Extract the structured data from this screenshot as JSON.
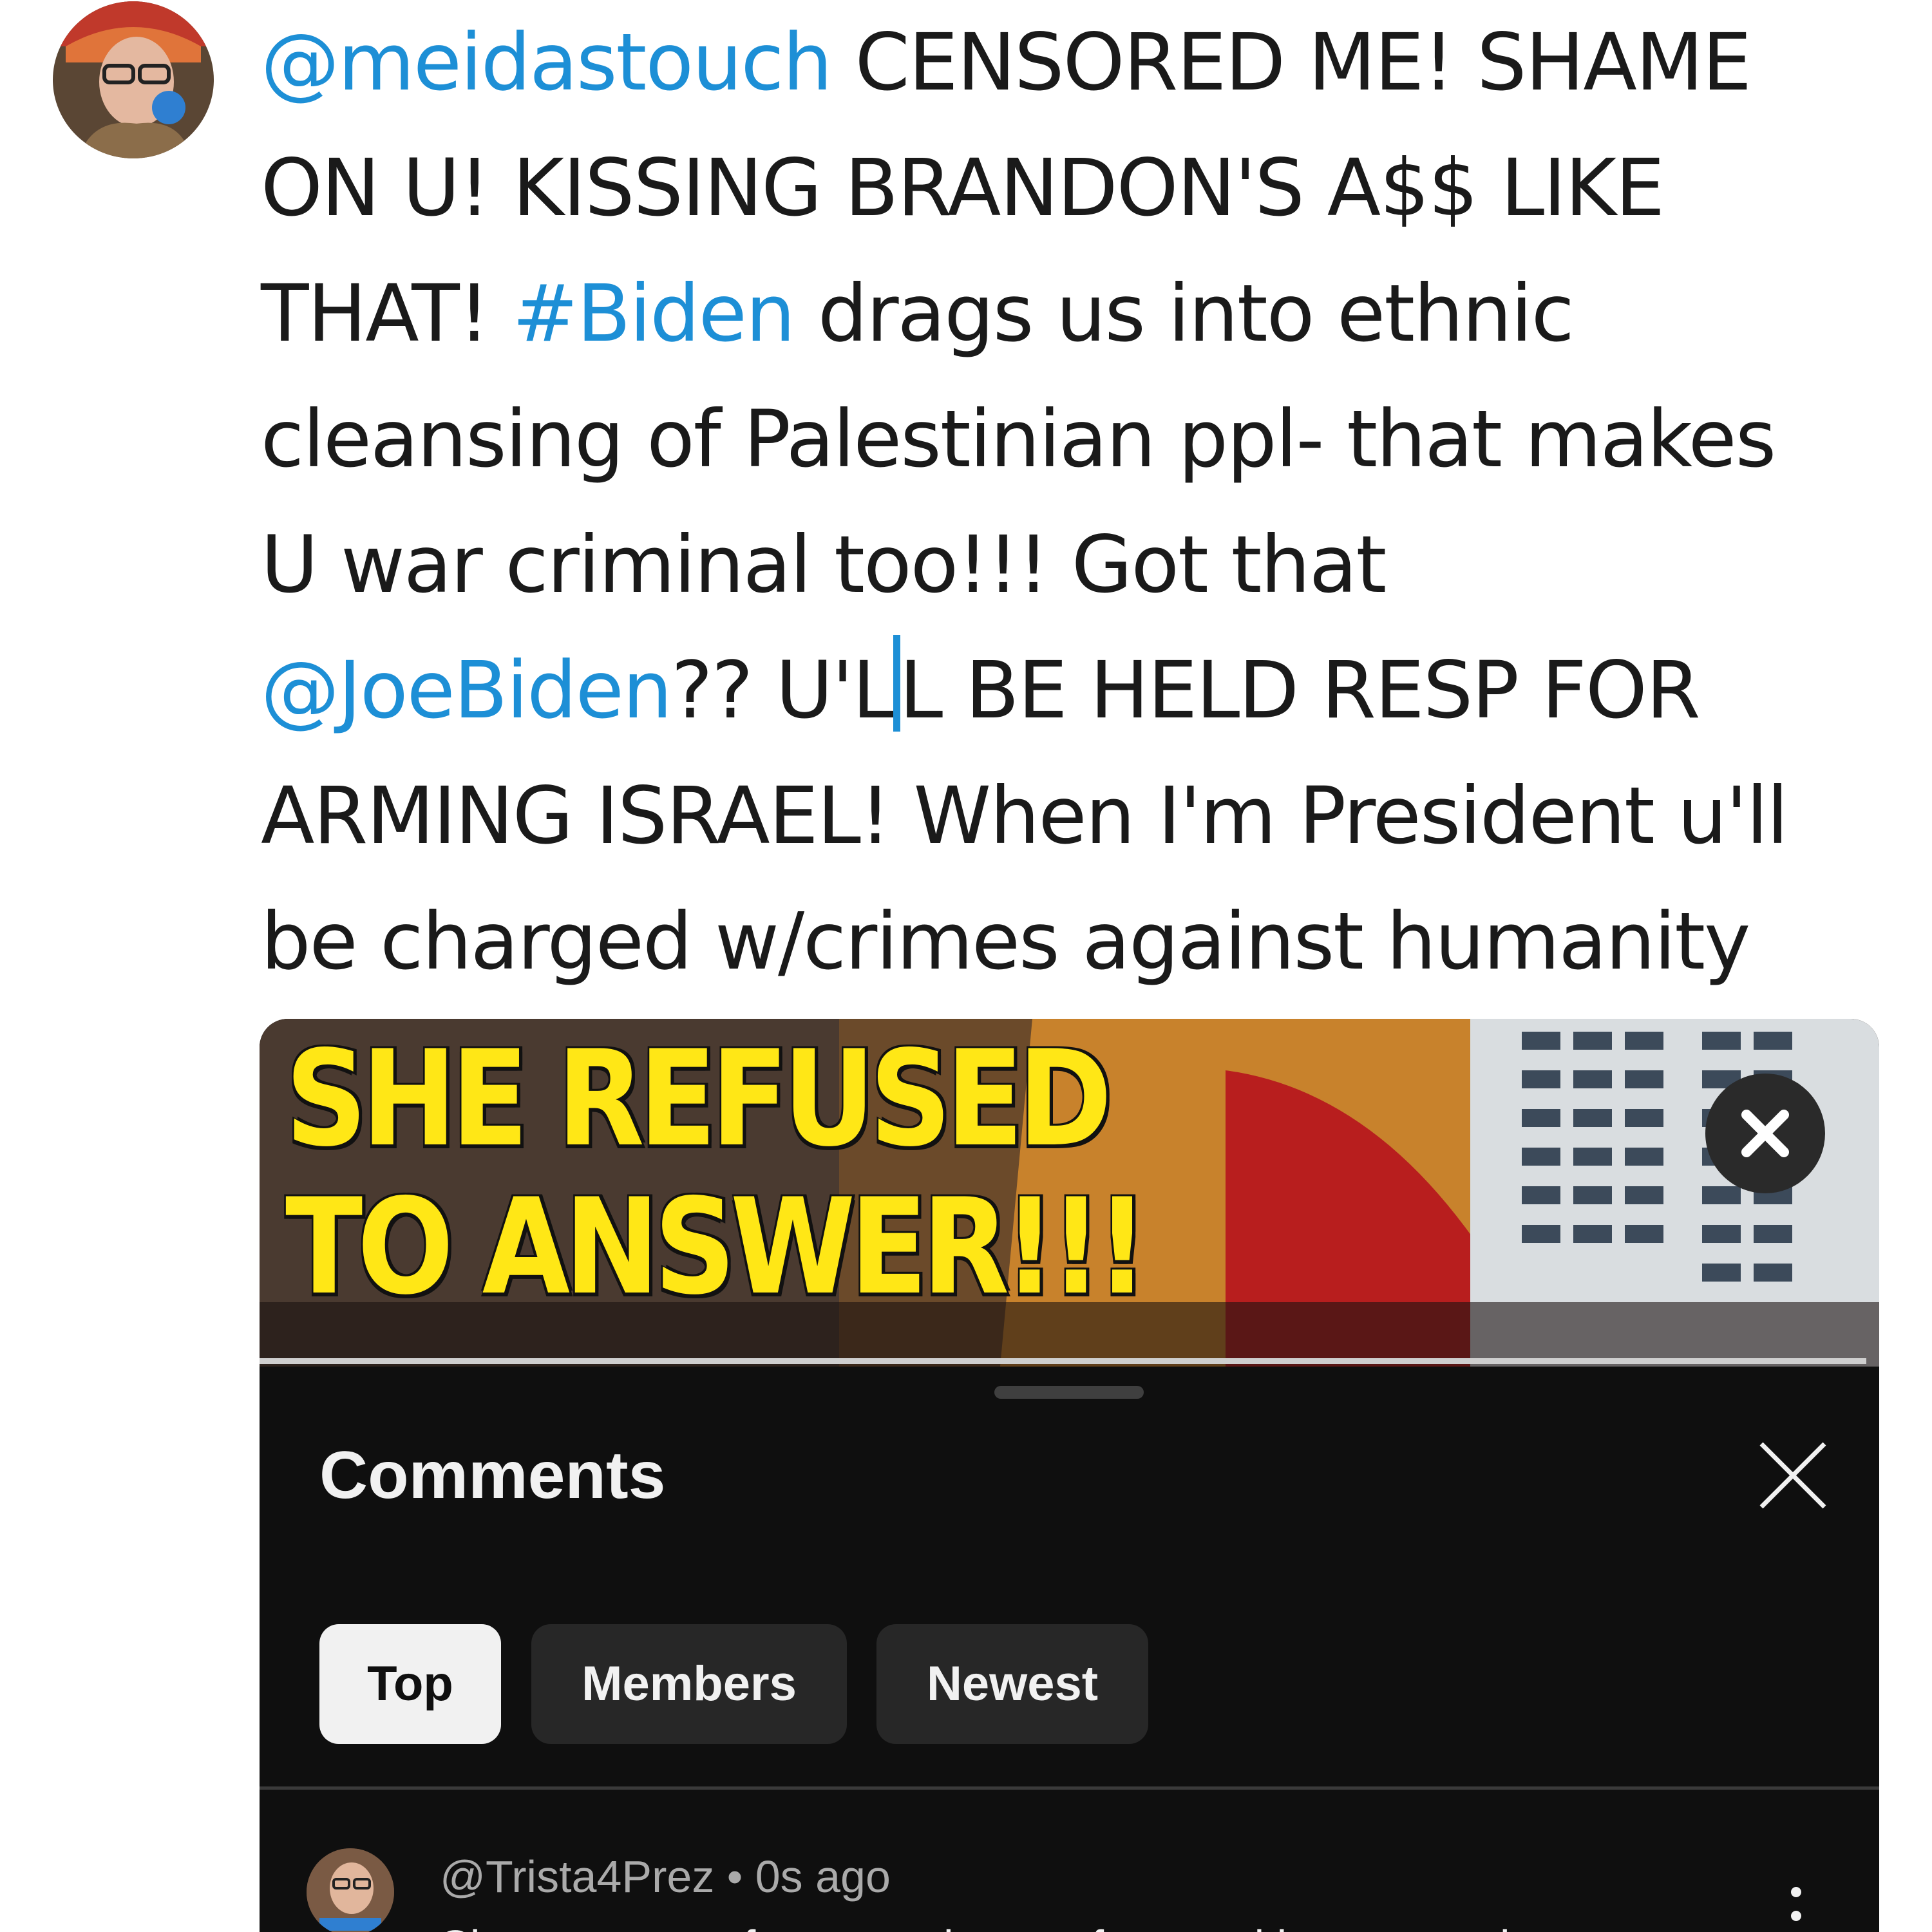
{
  "tweet": {
    "lines": [
      [
        {
          "t": "@meidastouch",
          "link": true
        },
        {
          "t": " CENSORED ME! SHAME"
        }
      ],
      [
        {
          "t": "ON U! KISSING BRANDON'S A$$ LIKE"
        }
      ],
      [
        {
          "t": "THAT! "
        },
        {
          "t": "#Biden",
          "link": true
        },
        {
          "t": " drags us into ethnic"
        }
      ],
      [
        {
          "t": "cleansing of Palestinian ppl- that makes"
        }
      ],
      [
        {
          "t": "U war criminal too!!! Got that"
        }
      ],
      [
        {
          "t": "@JoeBiden",
          "link": true
        },
        {
          "t": "?? U'L"
        },
        {
          "caret": true
        },
        {
          "t": "L BE HELD RESP FOR"
        }
      ],
      [
        {
          "t": "ARMING ISRAEL! When I'm President u'll"
        }
      ],
      [
        {
          "t": "be charged w/crimes against humanity"
        }
      ]
    ]
  },
  "video": {
    "headline_line1": "SHE REFUSED",
    "headline_line2": "TO ANSWER!!!"
  },
  "comments_sheet": {
    "title": "Comments",
    "filters": [
      "Top",
      "Members",
      "Newest"
    ],
    "active_filter": "Top",
    "comment": {
      "author": "@Trista4Prez",
      "separator": " • ",
      "time": "0s ago",
      "text": "Shame on you for censoring me for speaking out against"
    }
  },
  "colors": {
    "link": "#1d8fd6",
    "headline_yellow": "#ffe716",
    "sheet_bg": "#0f0f0f",
    "chip_bg": "#272727",
    "chip_active_bg": "#f1f1f1"
  },
  "icons": {
    "thumbnail_close": "close-icon",
    "sheet_close": "close-icon",
    "comment_menu": "more-vertical-icon"
  }
}
